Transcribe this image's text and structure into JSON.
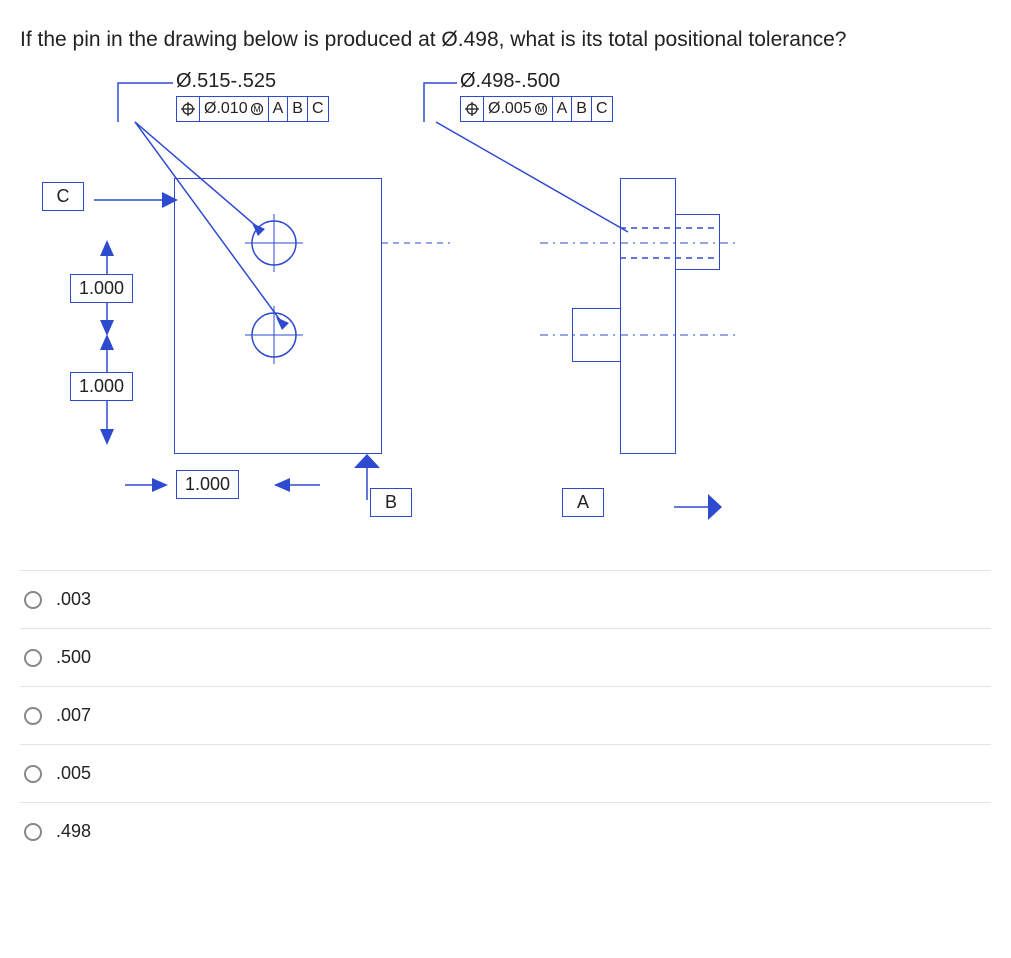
{
  "question": "If the pin in the drawing below is produced at Ø.498, what is its total positional tolerance?",
  "hole_callout": {
    "dim": "Ø.515-.525",
    "fcf_tol": "Ø.010",
    "fcf_mod": "M",
    "fcf_d1": "A",
    "fcf_d2": "B",
    "fcf_d3": "C"
  },
  "pin_callout": {
    "dim": "Ø.498-.500",
    "fcf_tol": "Ø.005",
    "fcf_mod": "M",
    "fcf_d1": "A",
    "fcf_d2": "B",
    "fcf_d3": "C"
  },
  "basic_dims": {
    "v1": "1.000",
    "v2": "1.000",
    "h1": "1.000"
  },
  "datums": {
    "A": "A",
    "B": "B",
    "C": "C"
  },
  "options": [
    ".003",
    ".500",
    ".007",
    ".005",
    ".498"
  ]
}
